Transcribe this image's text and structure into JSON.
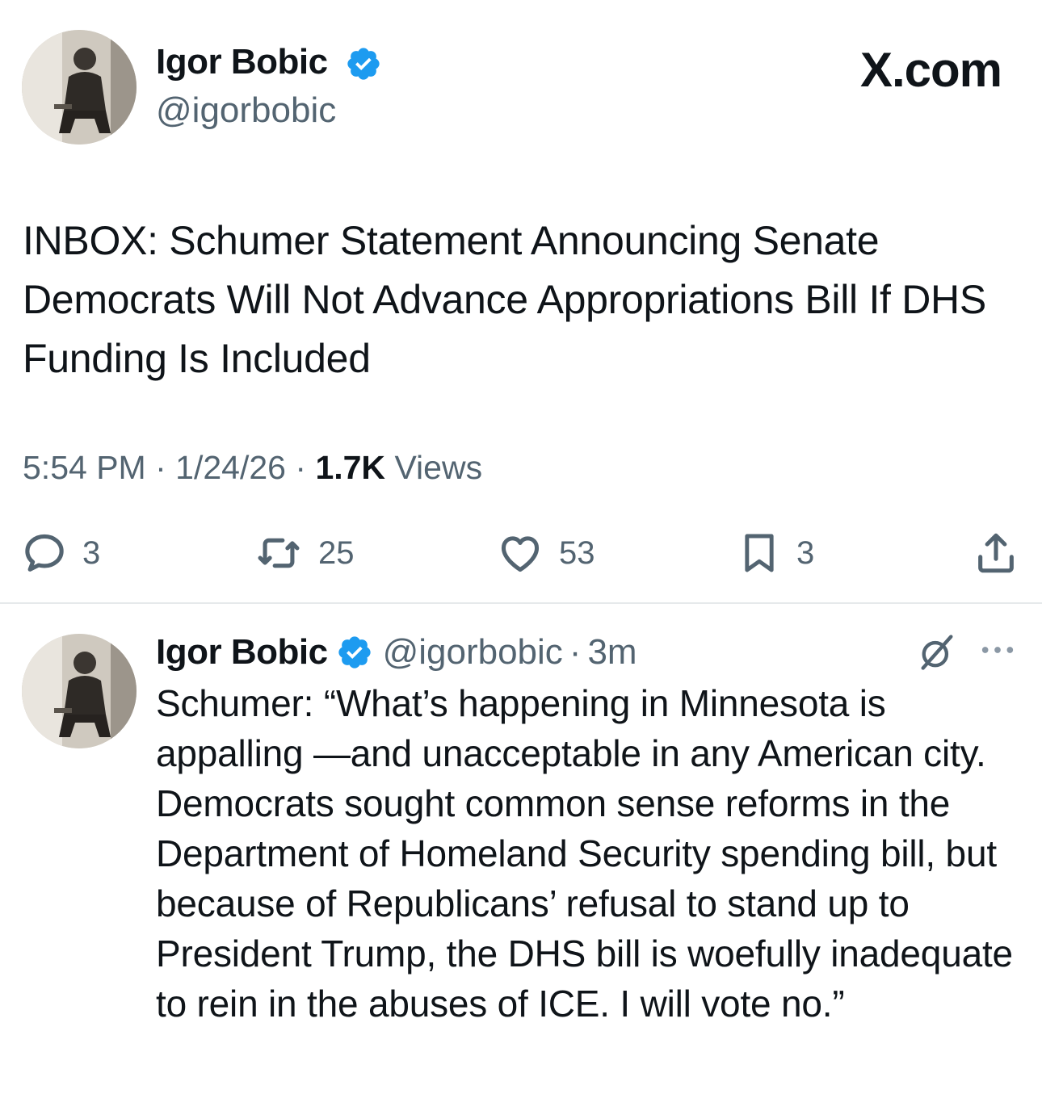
{
  "brand": "X.com",
  "colors": {
    "verified_blue": "#1d9bf0",
    "text_primary": "#0f1419",
    "text_secondary": "#536471",
    "divider": "#e6e9eb"
  },
  "icons": {
    "verified": "verified-badge-icon",
    "reply": "reply-bubble-icon",
    "repost": "repost-arrows-icon",
    "like": "heart-icon",
    "bookmark": "bookmark-icon",
    "share": "share-upload-icon",
    "grok": "grok-slash-icon",
    "more": "more-dots-icon"
  },
  "main_tweet": {
    "author_name": "Igor Bobic",
    "handle": "@igorbobic",
    "text": "INBOX: Schumer Statement Announcing Senate Democrats Will Not Advance Appropriations Bill If DHS Funding Is Included",
    "time": "5:54 PM",
    "separator": "·",
    "date": "1/24/26",
    "views_count": "1.7K",
    "views_label": "Views",
    "stats": {
      "replies": "3",
      "reposts": "25",
      "likes": "53",
      "bookmarks": "3"
    }
  },
  "reply_tweet": {
    "author_name": "Igor Bobic",
    "handle": "@igorbobic",
    "separator": "·",
    "time": "3m",
    "text": "Schumer: “What’s happening in Minnesota is appalling —and unacceptable in any American city. Democrats sought common sense reforms in the Department of Homeland Security spending bill, but because of Republicans’ refusal to stand up to President Trump, the DHS bill is woefully inadequate to rein in the abuses of ICE. I will vote no.”"
  }
}
